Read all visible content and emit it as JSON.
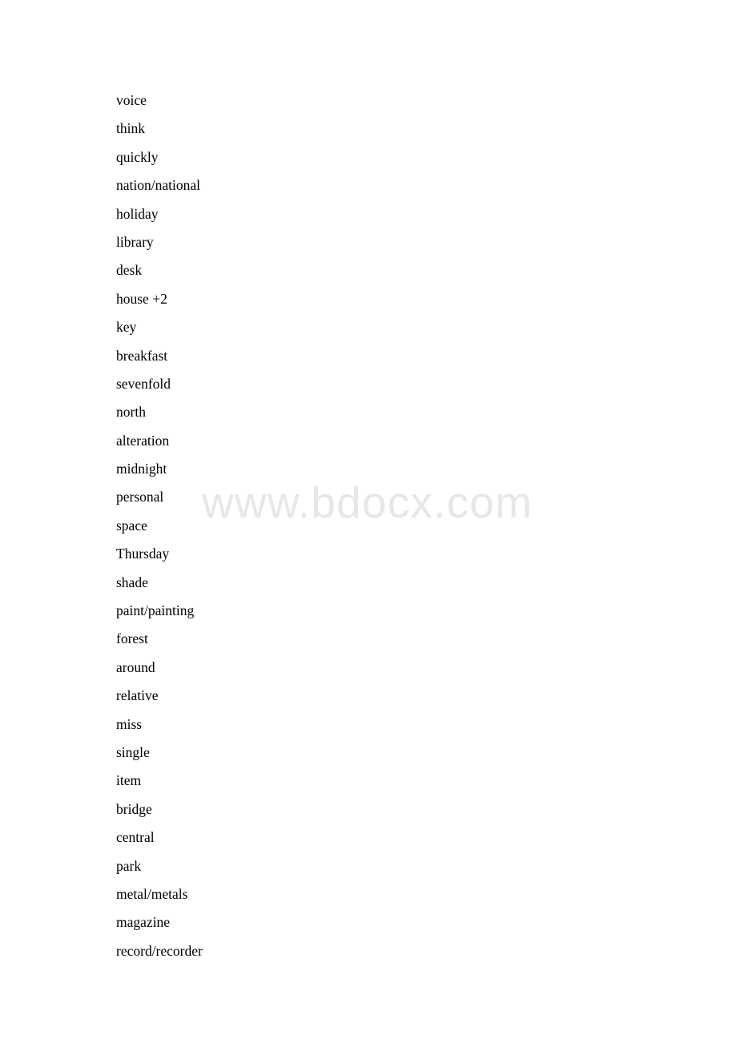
{
  "document": {
    "background_color": "#ffffff",
    "text_color": "#000000"
  },
  "watermark": {
    "text": "www.bdocx.com",
    "color": "#e7e7e7"
  },
  "word_list": {
    "items": [
      {
        "text": "voice"
      },
      {
        "text": "think"
      },
      {
        "text": "quickly"
      },
      {
        "text": "nation/national"
      },
      {
        "text": "holiday"
      },
      {
        "text": "library"
      },
      {
        "text": "desk"
      },
      {
        "text": "house +2"
      },
      {
        "text": "key"
      },
      {
        "text": "breakfast"
      },
      {
        "text": "sevenfold"
      },
      {
        "text": "north"
      },
      {
        "text": "alteration"
      },
      {
        "text": "midnight"
      },
      {
        "text": "personal"
      },
      {
        "text": "space"
      },
      {
        "text": "Thursday"
      },
      {
        "text": "shade"
      },
      {
        "text": "paint/painting"
      },
      {
        "text": "forest"
      },
      {
        "text": "around"
      },
      {
        "text": "relative"
      },
      {
        "text": "miss"
      },
      {
        "text": "single"
      },
      {
        "text": "item"
      },
      {
        "text": "bridge"
      },
      {
        "text": "central"
      },
      {
        "text": "park"
      },
      {
        "text": "metal/metals"
      },
      {
        "text": "magazine"
      },
      {
        "text": "record/recorder"
      }
    ]
  }
}
